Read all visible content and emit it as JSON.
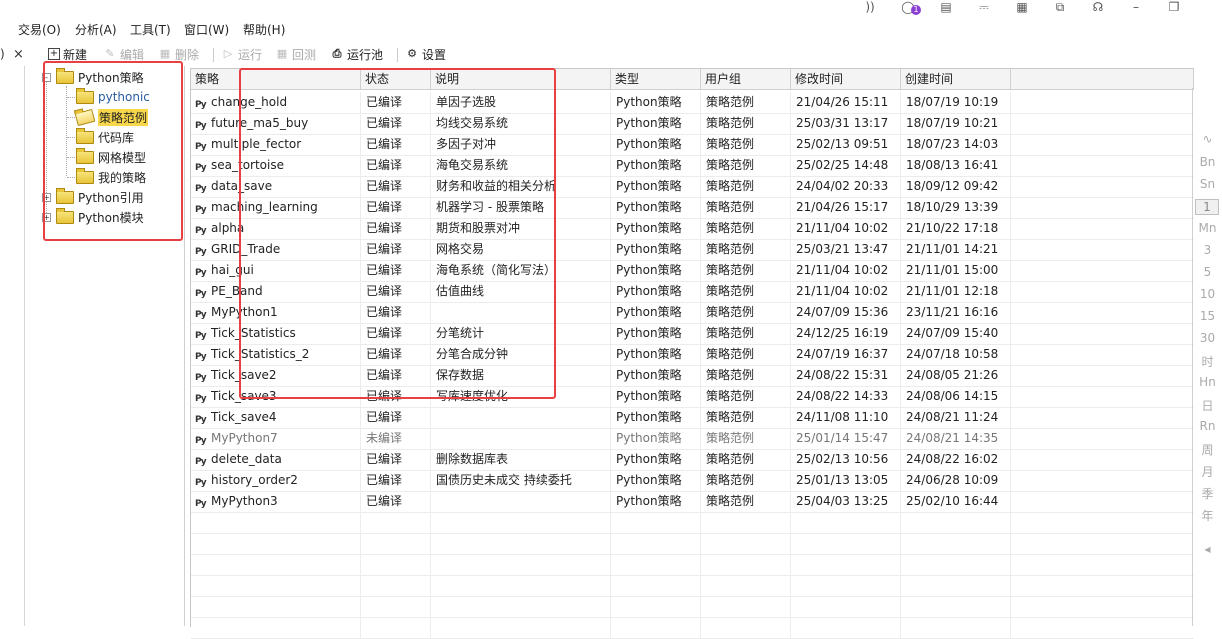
{
  "menu": [
    "交易(O)",
    "分析(A)",
    "工具(T)",
    "窗口(W)",
    "帮助(H)"
  ],
  "top_icons": [
    "rss-icon",
    "user-icon",
    "document-icon",
    "cart-icon",
    "script-icon",
    "copy-icon",
    "headset-icon",
    "minimize-icon",
    "restore-icon"
  ],
  "notification_count": "1",
  "toolbar": {
    "new": "新建",
    "edit": "编辑",
    "delete": "删除",
    "run": "运行",
    "backtest": "回测",
    "run_pool": "运行池",
    "settings": "设置"
  },
  "tree": {
    "nodes": [
      {
        "label": "Python策略"
      },
      {
        "label": "pythonic"
      },
      {
        "label": "策略范例"
      },
      {
        "label": "代码库"
      },
      {
        "label": "网格模型"
      },
      {
        "label": "我的策略"
      },
      {
        "label": "Python引用"
      },
      {
        "label": "Python模块"
      }
    ]
  },
  "table": {
    "columns": [
      "策略",
      "状态",
      "说明",
      "类型",
      "用户组",
      "修改时间",
      "创建时间"
    ],
    "rows": [
      [
        "change_hold",
        "已编译",
        "单因子选股",
        "Python策略",
        "策略范例",
        "21/04/26 15:11",
        "18/07/19 10:19"
      ],
      [
        "future_ma5_buy",
        "已编译",
        "均线交易系统",
        "Python策略",
        "策略范例",
        "25/03/31 13:17",
        "18/07/19 10:21"
      ],
      [
        "multiple_fector",
        "已编译",
        "多因子对冲",
        "Python策略",
        "策略范例",
        "25/02/13 09:51",
        "18/07/23 14:03"
      ],
      [
        "sea_tortoise",
        "已编译",
        "海龟交易系统",
        "Python策略",
        "策略范例",
        "25/02/25 14:48",
        "18/08/13 16:41"
      ],
      [
        "data_save",
        "已编译",
        "财务和收益的相关分析",
        "Python策略",
        "策略范例",
        "24/04/02 20:33",
        "18/09/12 09:42"
      ],
      [
        "maching_learning",
        "已编译",
        "机器学习 - 股票策略",
        "Python策略",
        "策略范例",
        "21/04/26 15:17",
        "18/10/29 13:39"
      ],
      [
        "alpha",
        "已编译",
        "期货和股票对冲",
        "Python策略",
        "策略范例",
        "21/11/04 10:02",
        "21/10/22 17:18"
      ],
      [
        "GRID_Trade",
        "已编译",
        "网格交易",
        "Python策略",
        "策略范例",
        "25/03/21 13:47",
        "21/11/01 14:21"
      ],
      [
        "hai_gui",
        "已编译",
        "海龟系统（简化写法）",
        "Python策略",
        "策略范例",
        "21/11/04 10:02",
        "21/11/01 15:00"
      ],
      [
        "PE_Band",
        "已编译",
        "估值曲线",
        "Python策略",
        "策略范例",
        "21/11/04 10:02",
        "21/11/01 12:18"
      ],
      [
        "MyPython1",
        "已编译",
        "",
        "Python策略",
        "策略范例",
        "24/07/09 15:36",
        "23/11/21 16:16"
      ],
      [
        "Tick_Statistics",
        "已编译",
        "分笔统计",
        "Python策略",
        "策略范例",
        "24/12/25 16:19",
        "24/07/09 15:40"
      ],
      [
        "Tick_Statistics_2",
        "已编译",
        "分笔合成分钟",
        "Python策略",
        "策略范例",
        "24/07/19 16:37",
        "24/07/18 10:58"
      ],
      [
        "Tick_save2",
        "已编译",
        "保存数据",
        "Python策略",
        "策略范例",
        "24/08/22 15:31",
        "24/08/05 21:26"
      ],
      [
        "Tick_save3",
        "已编译",
        "写库速度优化",
        "Python策略",
        "策略范例",
        "24/08/22 14:33",
        "24/08/06 14:15"
      ],
      [
        "Tick_save4",
        "已编译",
        "",
        "Python策略",
        "策略范例",
        "24/11/08 11:10",
        "24/08/21 11:24"
      ],
      [
        "MyPython7",
        "未编译",
        "",
        "Python策略",
        "策略范例",
        "25/01/14 15:47",
        "24/08/21 14:35"
      ],
      [
        "delete_data",
        "已编译",
        "删除数据库表",
        "Python策略",
        "策略范例",
        "25/02/13 10:56",
        "24/08/22 16:02"
      ],
      [
        "history_order2",
        "已编译",
        "国债历史未成交 持续委托",
        "Python策略",
        "策略范例",
        "25/01/13 13:05",
        "24/06/28 10:09"
      ],
      [
        "MyPython3",
        "已编译",
        "",
        "Python策略",
        "策略范例",
        "25/04/03 13:25",
        "25/02/10 16:44"
      ]
    ]
  },
  "right_periods": [
    "Bn",
    "Sn",
    "1",
    "Mn",
    "3",
    "5",
    "10",
    "15",
    "30",
    "时",
    "Hn",
    "日",
    "Rn",
    "周",
    "月",
    "季",
    "年"
  ],
  "close_label": "×",
  "left_label": ")"
}
